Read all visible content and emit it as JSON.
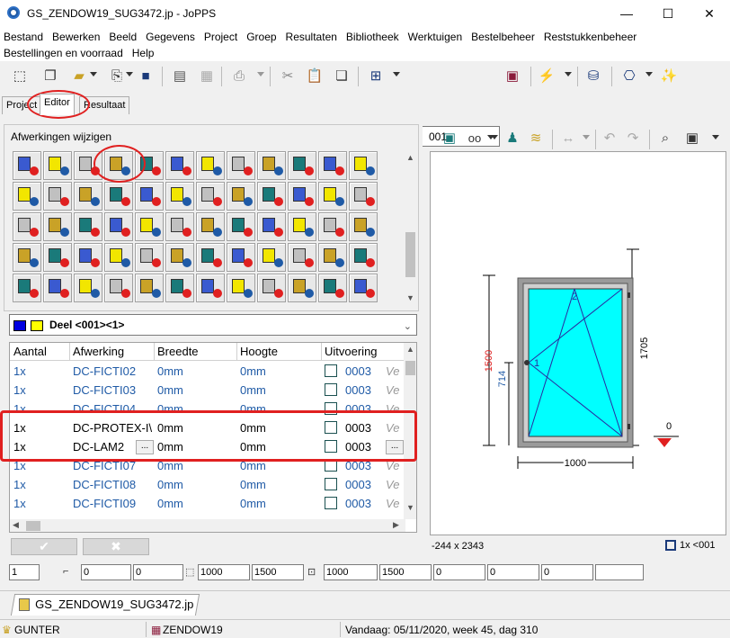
{
  "window": {
    "title": "GS_ZENDOW19_SUG3472.jp - JoPPS",
    "minimize": "—",
    "maximize": "☐",
    "close": "✕"
  },
  "menu": [
    "Bestand",
    "Bewerken",
    "Beeld",
    "Gegevens",
    "Project",
    "Groep",
    "Resultaten",
    "Bibliotheek",
    "Werktuigen",
    "Bestelbeheer",
    "Reststukkenbeheer",
    "Bestellingen en voorraad",
    "Help"
  ],
  "toolbar": {
    "combo_value": "001"
  },
  "tabs": [
    {
      "label": "Project"
    },
    {
      "label": "Editor",
      "active": true
    },
    {
      "label": "Resultaat"
    }
  ],
  "panel": {
    "title": "Afwerkingen wijzigen"
  },
  "deel": {
    "label": "Deel <001><1>"
  },
  "table": {
    "headers": [
      "Aantal",
      "Afwerking",
      "Breedte",
      "Hoogte",
      "Uitvoering"
    ],
    "rows": [
      {
        "aantal": "1x",
        "afwerking": "DC-FICTI02",
        "breedte": "0mm",
        "hoogte": "0mm",
        "uitvoering": "0003",
        "extra": "Ve",
        "style": "blue"
      },
      {
        "aantal": "1x",
        "afwerking": "DC-FICTI03",
        "breedte": "0mm",
        "hoogte": "0mm",
        "uitvoering": "0003",
        "extra": "Ve",
        "style": "blue"
      },
      {
        "aantal": "1x",
        "afwerking": "DC-FICTI04",
        "breedte": "0mm",
        "hoogte": "0mm",
        "uitvoering": "0003",
        "extra": "Ve",
        "style": "blue"
      },
      {
        "aantal": "1x",
        "afwerking": "DC-PROTEX-I\\",
        "breedte": "0mm",
        "hoogte": "0mm",
        "uitvoering": "0003",
        "extra": "Ve",
        "style": "black"
      },
      {
        "aantal": "1x",
        "afwerking": "DC-LAM2",
        "breedte": "0mm",
        "hoogte": "0mm",
        "uitvoering": "0003",
        "extra": "",
        "style": "white"
      },
      {
        "aantal": "1x",
        "afwerking": "DC-FICTI07",
        "breedte": "0mm",
        "hoogte": "0mm",
        "uitvoering": "0003",
        "extra": "Ve",
        "style": "blue"
      },
      {
        "aantal": "1x",
        "afwerking": "DC-FICTI08",
        "breedte": "0mm",
        "hoogte": "0mm",
        "uitvoering": "0003",
        "extra": "Ve",
        "style": "blue"
      },
      {
        "aantal": "1x",
        "afwerking": "DC-FICTI09",
        "breedte": "0mm",
        "hoogte": "0mm",
        "uitvoering": "0003",
        "extra": "Ve",
        "style": "blue"
      }
    ]
  },
  "drawing": {
    "width_label": "1000",
    "height_red": "1500",
    "height_total": "1705",
    "handle_height": "714",
    "marker_1": "1",
    "marker_2": "2",
    "marker_0": "0"
  },
  "status": {
    "dimensions": "-244 x 2343",
    "count": "1x <001"
  },
  "fields": [
    "1",
    "0",
    "0",
    "1000",
    "1500",
    "1000",
    "1500",
    "0",
    "0",
    "0"
  ],
  "doc_tab": "GS_ZENDOW19_SUG3472.jp",
  "statusbar": {
    "user": "GUNTER",
    "project": "ZENDOW19",
    "date": "Vandaag: 05/11/2020, week 45, dag 310"
  },
  "colors": {
    "glass": "#00ffff",
    "frame": "#9a9a9a",
    "highlight": "#e02020",
    "link_blue": "#1f5aa6"
  }
}
